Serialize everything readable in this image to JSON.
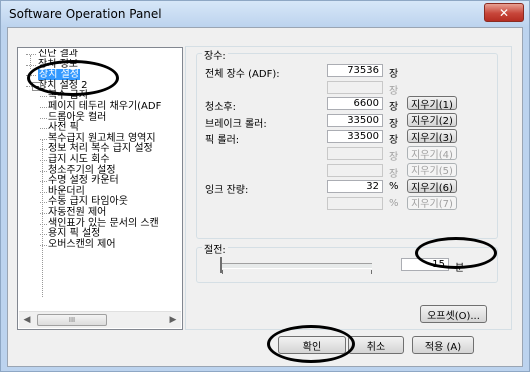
{
  "window": {
    "title": "Software Operation Panel",
    "close_label": "✕"
  },
  "tree": {
    "items": [
      {
        "label": "진단 결과",
        "level": 1
      },
      {
        "label": "장치 정보",
        "level": 1
      },
      {
        "label": "장치 설정",
        "level": 1,
        "selected": true
      },
      {
        "label": "장치 설정 2",
        "level": 1,
        "expander": "−"
      },
      {
        "label": "복수 급지",
        "level": 2
      },
      {
        "label": "페이지 테두리 채우기(ADF",
        "level": 2
      },
      {
        "label": "드롭아웃 컬러",
        "level": 2
      },
      {
        "label": "사전 픽",
        "level": 2
      },
      {
        "label": "복수급지 원고체크 영역지",
        "level": 2
      },
      {
        "label": "정보 처리 복수 급지 설정",
        "level": 2
      },
      {
        "label": "급지 시도 회수",
        "level": 2
      },
      {
        "label": "청소주기의 설정",
        "level": 2
      },
      {
        "label": "수명 설정 카운터",
        "level": 2
      },
      {
        "label": "바운더리",
        "level": 2
      },
      {
        "label": "수동 급지 타임아웃",
        "level": 2
      },
      {
        "label": "자동전원 제어",
        "level": 2
      },
      {
        "label": "색인표가 있는 문서의 스캔",
        "level": 2
      },
      {
        "label": "용지 픽 설정",
        "level": 2
      },
      {
        "label": "오버스캔의 제어",
        "level": 2
      }
    ],
    "scroll_left_icon": "◀",
    "scroll_right_icon": "▶",
    "scroll_thumb_grip": "III"
  },
  "sheets": {
    "legend": "장수:",
    "rows": [
      {
        "label": "전체 장수 (ADF):",
        "value": "73536",
        "unit": "장",
        "enabled": true,
        "button": null
      },
      {
        "label": "",
        "value": "",
        "unit": "장",
        "enabled": false,
        "button": null
      },
      {
        "label": "청소후:",
        "value": "6600",
        "unit": "장",
        "enabled": true,
        "button": "지우기(1)",
        "button_enabled": true
      },
      {
        "label": "브레이크 롤러:",
        "value": "33500",
        "unit": "장",
        "enabled": true,
        "button": "지우기(2)",
        "button_enabled": true
      },
      {
        "label": "픽 롤러:",
        "value": "33500",
        "unit": "장",
        "enabled": true,
        "button": "지우기(3)",
        "button_enabled": true
      },
      {
        "label": "",
        "value": "",
        "unit": "장",
        "enabled": false,
        "button": "지우기(4)",
        "button_enabled": false
      },
      {
        "label": "",
        "value": "",
        "unit": "장",
        "enabled": false,
        "button": "지우기(5)",
        "button_enabled": false
      },
      {
        "label": "잉크 잔량:",
        "value": "32",
        "unit": "%",
        "enabled": true,
        "button": "지우기(6)",
        "button_enabled": true
      },
      {
        "label": "",
        "value": "",
        "unit": "%",
        "enabled": false,
        "button": "지우기(7)",
        "button_enabled": false
      }
    ]
  },
  "power_save": {
    "legend": "절전:",
    "value": "15",
    "unit": "분"
  },
  "offset_button": "오프셋(O)...",
  "footer": {
    "ok": "확인",
    "cancel": "취소",
    "apply": "적용 (A)"
  }
}
